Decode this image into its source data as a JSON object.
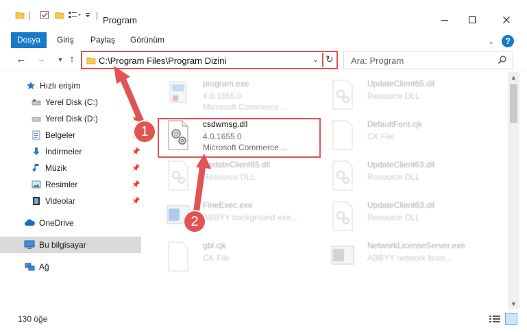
{
  "window": {
    "title": "Program",
    "controls": {
      "minimize": "—",
      "maximize": "☐",
      "close": "✕"
    }
  },
  "ribbon": {
    "tabs": [
      {
        "label": "Dosya",
        "active": true
      },
      {
        "label": "Giriş"
      },
      {
        "label": "Paylaş"
      },
      {
        "label": "Görünüm"
      }
    ],
    "accent_color": "#1979ca"
  },
  "address": {
    "path": "C:\\Program Files\\Program Dizini",
    "highlight_color": "#e05454"
  },
  "search": {
    "placeholder": "Ara: Program"
  },
  "sidebar": {
    "items": [
      {
        "label": "Hızlı erişim",
        "icon": "star-icon",
        "pinned": false
      },
      {
        "label": "Yerel Disk (C:)",
        "icon": "drive-icon",
        "pinned": false
      },
      {
        "label": "Yerel Disk (D:)",
        "icon": "drive-icon",
        "pinned": true
      },
      {
        "label": "Belgeler",
        "icon": "documents-icon",
        "pinned": true
      },
      {
        "label": "İndirmeler",
        "icon": "download-icon",
        "pinned": true
      },
      {
        "label": "Müzik",
        "icon": "music-icon",
        "pinned": true
      },
      {
        "label": "Resimler",
        "icon": "pictures-icon",
        "pinned": true
      },
      {
        "label": "Videolar",
        "icon": "video-icon",
        "pinned": true
      },
      {
        "label": "OneDrive",
        "icon": "cloud-icon",
        "pinned": false
      },
      {
        "label": "Bu bilgisayar",
        "icon": "computer-icon",
        "pinned": false,
        "selected": true
      },
      {
        "label": "Ağ",
        "icon": "network-icon",
        "pinned": false
      }
    ]
  },
  "files": [
    {
      "name": "program.exe",
      "line2": "4.0.1655.0",
      "line3": "Microsoft Commerce ...",
      "icon": "exe-icon",
      "faded": true
    },
    {
      "name": "UpdateClient65.dll",
      "line2": "Resource DLL",
      "line3": "",
      "icon": "dll-icon",
      "faded": true
    },
    {
      "name": "csdwmsg.dll",
      "line2": "4.0.1655.0",
      "line3": "Microsoft Commerce ...",
      "icon": "dll-gear-icon",
      "faded": false,
      "highlighted": true
    },
    {
      "name": "DefaultFont.cjk",
      "line2": "CK File",
      "line3": "",
      "icon": "file-icon",
      "faded": true
    },
    {
      "name": "UpdateClient65.dll",
      "line2": "Resource DLL",
      "line3": "",
      "icon": "dll-icon",
      "faded": true
    },
    {
      "name": "UpdateClient63.dll",
      "line2": "Resource DLL",
      "line3": "",
      "icon": "dll-icon",
      "faded": true
    },
    {
      "name": "FineExec.exe",
      "line2": "ABBYY background exe...",
      "line3": "",
      "icon": "app-icon",
      "faded": true
    },
    {
      "name": "UpdateClient63.dll",
      "line2": "Resource DLL",
      "line3": "",
      "icon": "dll-icon",
      "faded": true
    },
    {
      "name": "gbl.cjk",
      "line2": "CK File",
      "line3": "",
      "icon": "file-icon",
      "faded": true
    },
    {
      "name": "NetworkLicenseServer.exe",
      "line2": "ABBYY network licen...",
      "line3": "",
      "icon": "app-icon",
      "faded": true
    }
  ],
  "callouts": {
    "one": "1",
    "two": "2"
  },
  "status": {
    "count": "130 öğe"
  }
}
